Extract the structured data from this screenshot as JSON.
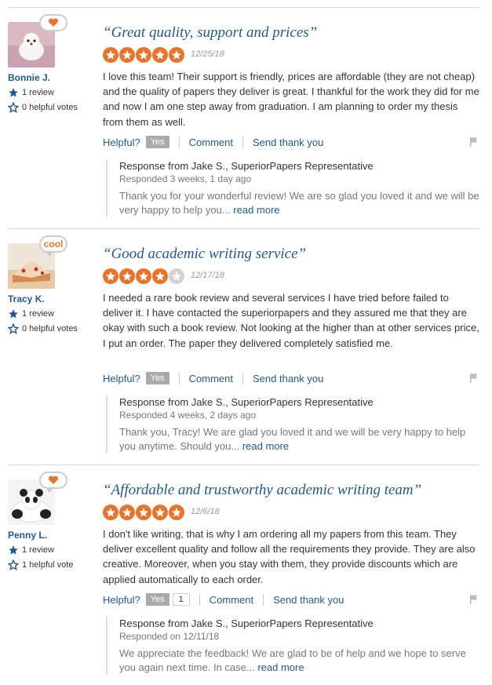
{
  "colors": {
    "accent": "#e8732a",
    "link": "#1f5a8f",
    "muted": "#999999"
  },
  "reviews": [
    {
      "badge": "heart-icon",
      "user": {
        "name": "Bonnie J.",
        "reviews": "1 review",
        "helpful_votes": "0 helpful votes"
      },
      "title": "“Great quality, support and prices”",
      "rating": 5,
      "date": "12/25/18",
      "text": "I love this team! Their support is friendly, prices are affordable (they are not cheap) and the quality of papers they deliver is great. I thankful for the work they did for me and now I am one step away from graduation. I am planning to order my thesis from them as well.",
      "actions": {
        "helpful": "Helpful?",
        "yes": "Yes",
        "comment": "Comment",
        "thank": "Send thank you"
      },
      "response": {
        "from": "Response from Jake S., SuperiorPapers Representative",
        "when": "Responded 3 weeks, 1 day ago",
        "text": "Thank you for your wonderful review! We are so glad you loved it and we will be very happy to help you...",
        "read_more": "read more"
      }
    },
    {
      "badge_text": "cool",
      "user": {
        "name": "Tracy K.",
        "reviews": "1 review",
        "helpful_votes": "0 helpful votes"
      },
      "title": "“Good academic writing service”",
      "rating": 4,
      "date": "12/17/18",
      "text": "I needed a rare book review and several services I have tried before failed to deliver it. I have contacted the superiorpapers and they assured me that they are okay with such a book review. Not looking at the higher than at other services price, I put an order. The paper they delivered completely satisfied me.",
      "actions": {
        "helpful": "Helpful?",
        "yes": "Yes",
        "comment": "Comment",
        "thank": "Send thank you"
      },
      "response": {
        "from": "Response from Jake S., SuperiorPapers Representative",
        "when": "Responded 4 weeks, 2 days ago",
        "text": "Thank you, Tracy! We are glad you loved it and we will be very happy to help you anytime. Should you...",
        "read_more": "read more"
      }
    },
    {
      "badge": "heart-icon",
      "user": {
        "name": "Penny L.",
        "reviews": "1 review",
        "helpful_votes": "1 helpful vote"
      },
      "title": "“Affordable and trustworthy academic writing team”",
      "rating": 5,
      "date": "12/6/18",
      "text": "I don't like writing, that is why I am ordering all my papers from this team. They deliver excellent quality and follow all the requirements they provide. They are also creative. Moreover, when you stay with them, they provide discounts which are applied automatically to each order.",
      "actions": {
        "helpful": "Helpful?",
        "yes": "Yes",
        "yes_count": "1",
        "comment": "Comment",
        "thank": "Send thank you"
      },
      "response": {
        "from": "Response from Jake S., SuperiorPapers Representative",
        "when": "Responded on 12/11/18",
        "text": "We appreciate the feedback! We are glad to be of help and we hope to serve you again next time. In case...",
        "read_more": "read more"
      }
    }
  ]
}
